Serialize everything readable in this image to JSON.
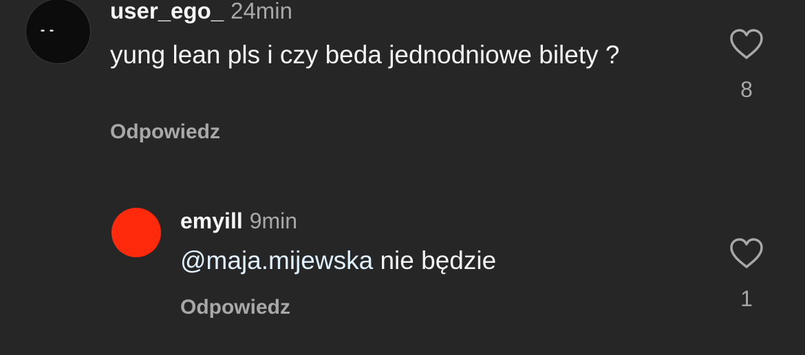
{
  "comments": [
    {
      "username": "user_ego_",
      "time": "24min",
      "text": "yung lean pls i czy beda jednodniowe bilety ?",
      "reply_label": "Odpowiedz",
      "likes": "8",
      "avatar_color": "#0c0c0c"
    },
    {
      "username": "emyill",
      "time": "9min",
      "mention": "@maja.mijewska",
      "text": " nie będzie",
      "reply_label": "Odpowiedz",
      "likes": "1",
      "avatar_color": "#ff2a0c"
    }
  ],
  "icons": {
    "like": "heart-outline-icon"
  },
  "colors": {
    "background": "#262626",
    "primary_text": "#f5f5f5",
    "secondary_text": "#a8a8a8",
    "mention": "#e0f1ff"
  }
}
